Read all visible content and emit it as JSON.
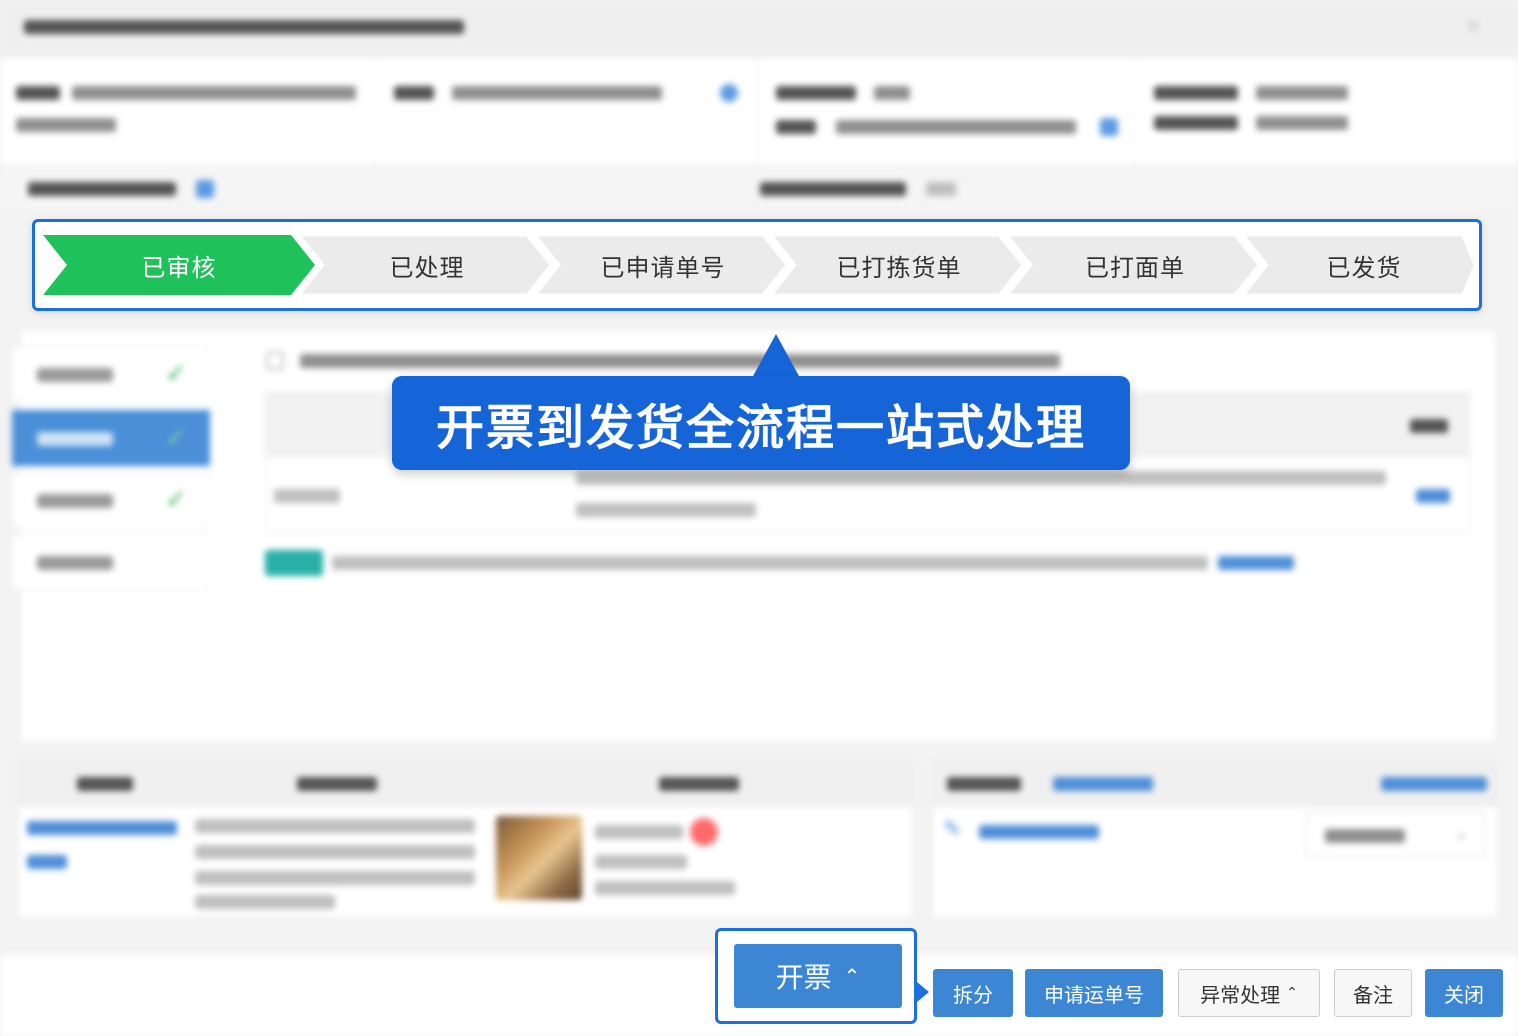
{
  "steps": [
    {
      "label": "已审核",
      "state": "done"
    },
    {
      "label": "已处理",
      "state": "pending"
    },
    {
      "label": "已申请单号",
      "state": "pending"
    },
    {
      "label": "已打拣货单",
      "state": "pending"
    },
    {
      "label": "已打面单",
      "state": "pending"
    },
    {
      "label": "已发货",
      "state": "pending"
    }
  ],
  "callout": {
    "text": "开票到发货全流程一站式处理"
  },
  "footer": {
    "invoice_label": "开票",
    "split_label": "拆分",
    "apply_tracking_label": "申请运单号",
    "exception_label": "异常处理",
    "remark_label": "备注",
    "close_label": "关闭"
  },
  "colors": {
    "accent": "#1565d8",
    "step_done": "#1ec15a",
    "primary_button": "#3d86d4"
  },
  "icons": [
    "check-icon",
    "chevron-up-icon",
    "close-icon",
    "edit-icon"
  ]
}
